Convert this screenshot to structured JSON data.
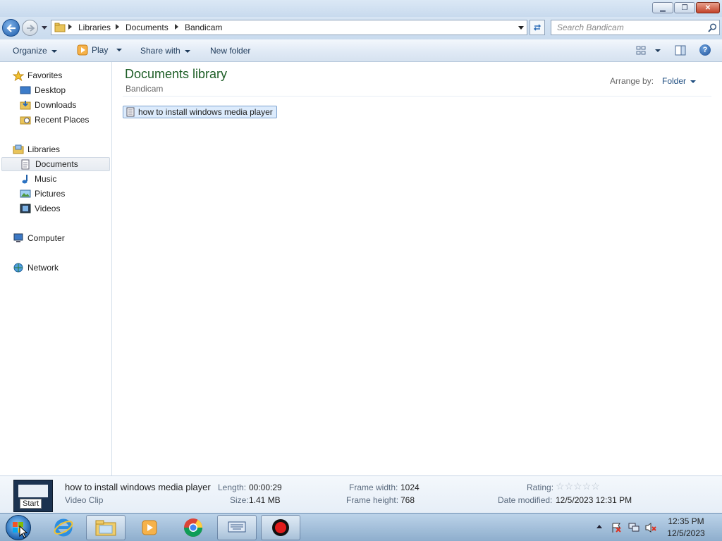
{
  "window": {
    "minimize_glyph": "▁",
    "maximize_glyph": "❐",
    "close_glyph": "✕"
  },
  "address": {
    "breadcrumbs": [
      "Libraries",
      "Documents",
      "Bandicam"
    ],
    "search_placeholder": "Search Bandicam"
  },
  "toolbar": {
    "organize": "Organize",
    "play": "Play",
    "share_with": "Share with",
    "new_folder": "New folder",
    "help_glyph": "?"
  },
  "nav": {
    "favorites": {
      "label": "Favorites",
      "items": [
        {
          "label": "Desktop",
          "icon": "desktop-icon"
        },
        {
          "label": "Downloads",
          "icon": "downloads-icon"
        },
        {
          "label": "Recent Places",
          "icon": "recent-places-icon"
        }
      ]
    },
    "libraries": {
      "label": "Libraries",
      "items": [
        {
          "label": "Documents",
          "icon": "documents-icon",
          "selected": true
        },
        {
          "label": "Music",
          "icon": "music-icon"
        },
        {
          "label": "Pictures",
          "icon": "pictures-icon"
        },
        {
          "label": "Videos",
          "icon": "videos-icon"
        }
      ]
    },
    "computer": "Computer",
    "network": "Network"
  },
  "content": {
    "title": "Documents library",
    "subtitle": "Bandicam",
    "arrange_label": "Arrange by:",
    "arrange_value": "Folder",
    "files": [
      {
        "name": "how to install windows media player",
        "selected": true
      }
    ]
  },
  "details": {
    "name": "how to install windows media player",
    "type": "Video Clip",
    "thumbnail_caption": "Start",
    "length_label": "Length:",
    "length_value": "00:00:29",
    "size_label": "Size:",
    "size_value": "1.41 MB",
    "frame_width_label": "Frame width:",
    "frame_width_value": "1024",
    "frame_height_label": "Frame height:",
    "frame_height_value": "768",
    "rating_label": "Rating:",
    "rating_stars": 0,
    "date_modified_label": "Date modified:",
    "date_modified_value": "12/5/2023 12:31 PM"
  },
  "taskbar": {
    "pinned": [
      "start-orb",
      "internet-explorer",
      "windows-explorer",
      "media-player",
      "chrome",
      "on-screen-keyboard",
      "bandicam"
    ],
    "active": "windows-explorer",
    "time": "12:35 PM",
    "date": "12/5/2023"
  },
  "colors": {
    "library_title": "#1e5e27",
    "selection_fill": "#dcebfc",
    "selection_border": "#7da2ce",
    "close_button": "#c2432a"
  }
}
